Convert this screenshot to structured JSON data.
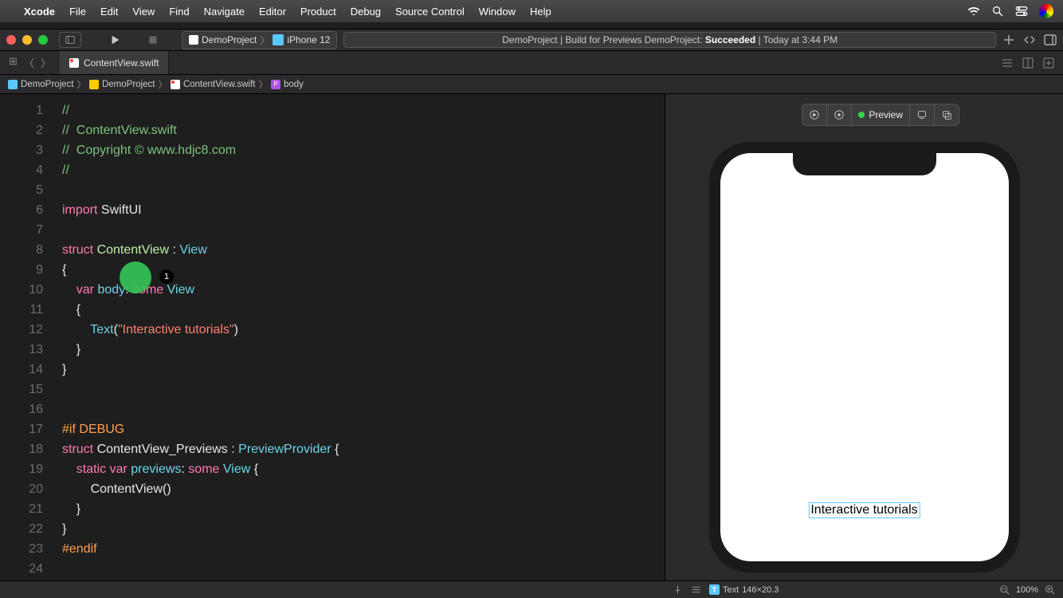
{
  "menubar": {
    "app": "Xcode",
    "items": [
      "File",
      "Edit",
      "View",
      "Find",
      "Navigate",
      "Editor",
      "Product",
      "Debug",
      "Source Control",
      "Window",
      "Help"
    ]
  },
  "toolbar": {
    "scheme_project": "DemoProject",
    "scheme_device": "iPhone 12",
    "status_prefix": "DemoProject | Build for Previews DemoProject: ",
    "status_result": "Succeeded",
    "status_time": " | Today at 3:44 PM"
  },
  "tab": {
    "filename": "ContentView.swift"
  },
  "breadcrumb": {
    "items": [
      "DemoProject",
      "DemoProject",
      "ContentView.swift",
      "body"
    ]
  },
  "code": {
    "line_count": 24,
    "lines": [
      {
        "n": 1,
        "segs": [
          {
            "c": "c-comment",
            "t": "//"
          }
        ]
      },
      {
        "n": 2,
        "segs": [
          {
            "c": "c-comment",
            "t": "//  ContentView.swift"
          }
        ]
      },
      {
        "n": 3,
        "segs": [
          {
            "c": "c-comment",
            "t": "//  Copyright © www.hdjc8.com"
          }
        ]
      },
      {
        "n": 4,
        "segs": [
          {
            "c": "c-comment",
            "t": "//"
          }
        ]
      },
      {
        "n": 5,
        "segs": []
      },
      {
        "n": 6,
        "segs": [
          {
            "c": "c-kw",
            "t": "import"
          },
          {
            "c": "c-ident",
            "t": " SwiftUI"
          }
        ]
      },
      {
        "n": 7,
        "segs": []
      },
      {
        "n": 8,
        "segs": [
          {
            "c": "c-kw",
            "t": "struct"
          },
          {
            "c": "c-ident",
            "t": " "
          },
          {
            "c": "c-type2",
            "t": "ContentView"
          },
          {
            "c": "c-ident",
            "t": " : "
          },
          {
            "c": "c-type",
            "t": "View"
          }
        ]
      },
      {
        "n": 9,
        "segs": [
          {
            "c": "c-ident",
            "t": "{"
          }
        ]
      },
      {
        "n": 10,
        "segs": [
          {
            "c": "c-ident",
            "t": "    "
          },
          {
            "c": "c-kw",
            "t": "var"
          },
          {
            "c": "c-ident",
            "t": " "
          },
          {
            "c": "c-type",
            "t": "body"
          },
          {
            "c": "c-ident",
            "t": ": "
          },
          {
            "c": "c-kw",
            "t": "some"
          },
          {
            "c": "c-ident",
            "t": " "
          },
          {
            "c": "c-type",
            "t": "View"
          }
        ]
      },
      {
        "n": 11,
        "segs": [
          {
            "c": "c-ident",
            "t": "    {"
          }
        ]
      },
      {
        "n": 12,
        "segs": [
          {
            "c": "c-ident",
            "t": "        "
          },
          {
            "c": "c-type",
            "t": "Text"
          },
          {
            "c": "c-ident",
            "t": "("
          },
          {
            "c": "c-str",
            "t": "\"Interactive tutorials\""
          },
          {
            "c": "c-ident",
            "t": ")"
          }
        ]
      },
      {
        "n": 13,
        "segs": [
          {
            "c": "c-ident",
            "t": "    }"
          }
        ]
      },
      {
        "n": 14,
        "segs": [
          {
            "c": "c-ident",
            "t": "}"
          }
        ]
      },
      {
        "n": 15,
        "segs": []
      },
      {
        "n": 16,
        "segs": []
      },
      {
        "n": 17,
        "segs": [
          {
            "c": "c-preproc",
            "t": "#if DEBUG"
          }
        ]
      },
      {
        "n": 18,
        "segs": [
          {
            "c": "c-kw",
            "t": "struct"
          },
          {
            "c": "c-ident",
            "t": " ContentView_Previews : "
          },
          {
            "c": "c-type",
            "t": "PreviewProvider"
          },
          {
            "c": "c-ident",
            "t": " {"
          }
        ]
      },
      {
        "n": 19,
        "segs": [
          {
            "c": "c-ident",
            "t": "    "
          },
          {
            "c": "c-kw",
            "t": "static"
          },
          {
            "c": "c-ident",
            "t": " "
          },
          {
            "c": "c-kw",
            "t": "var"
          },
          {
            "c": "c-ident",
            "t": " "
          },
          {
            "c": "c-type",
            "t": "previews"
          },
          {
            "c": "c-ident",
            "t": ": "
          },
          {
            "c": "c-kw",
            "t": "some"
          },
          {
            "c": "c-ident",
            "t": " "
          },
          {
            "c": "c-type",
            "t": "View"
          },
          {
            "c": "c-ident",
            "t": " {"
          }
        ]
      },
      {
        "n": 20,
        "segs": [
          {
            "c": "c-ident",
            "t": "        ContentView()"
          }
        ]
      },
      {
        "n": 21,
        "segs": [
          {
            "c": "c-ident",
            "t": "    }"
          }
        ]
      },
      {
        "n": 22,
        "segs": [
          {
            "c": "c-ident",
            "t": "}"
          }
        ]
      },
      {
        "n": 23,
        "segs": [
          {
            "c": "c-preproc",
            "t": "#endif"
          }
        ]
      },
      {
        "n": 24,
        "segs": []
      }
    ]
  },
  "cursor": {
    "badge": "1"
  },
  "preview": {
    "live_label": "Preview",
    "rendered_text": "Interactive tutorials"
  },
  "bottombar": {
    "element_label": "Text",
    "element_size": "146×20.3",
    "zoom": "100%"
  }
}
